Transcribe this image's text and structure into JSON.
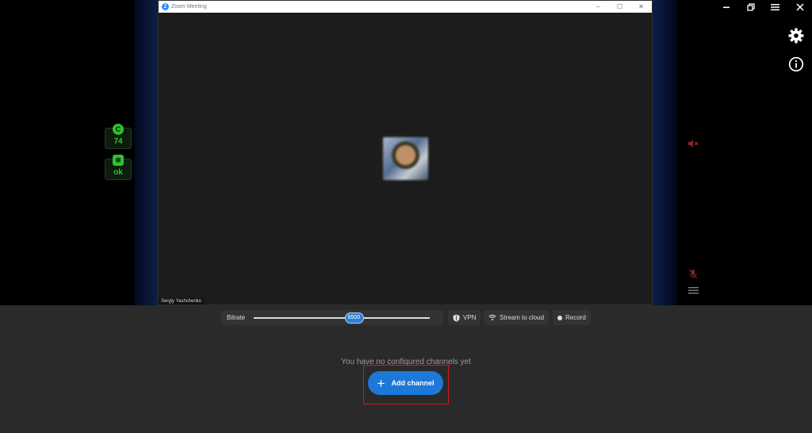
{
  "zoom": {
    "title": "Zoom Meeting",
    "logo_letter": "Z",
    "participant": "Sergiy Yashchenko"
  },
  "indicators": [
    {
      "icon_letter": "C",
      "value": "74",
      "icon": "cpu-icon"
    },
    {
      "icon_letter": "✲",
      "value": "ok",
      "icon": "network-icon"
    }
  ],
  "controls": {
    "bitrate_label": "Bitrate",
    "bitrate_value": "6500",
    "bitrate_fraction": 0.57,
    "vpn_label": "VPN",
    "stream_label": "Stream to cloud",
    "record_label": "Record"
  },
  "empty_message": "You have no configured channels yet",
  "add_channel_label": "Add channel",
  "colors": {
    "accent": "#1e78d7",
    "indicator": "#2fc22f",
    "highlight": "#d21d1d",
    "muted_red": "#a03030"
  }
}
